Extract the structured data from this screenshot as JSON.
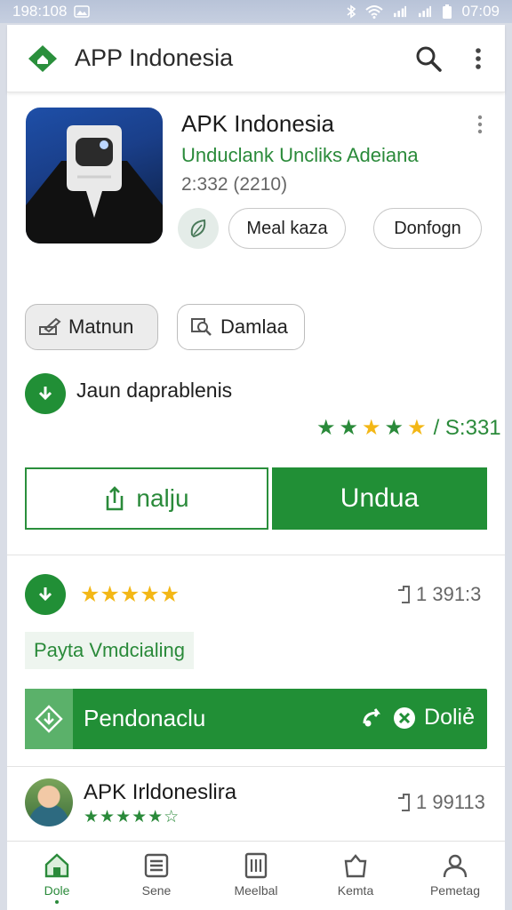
{
  "status_bar": {
    "left_text": "198:108",
    "time": "07:09"
  },
  "top_bar": {
    "title": "APP Indonesia",
    "icons": [
      "home-logo-icon",
      "search-icon",
      "more-vert-icon"
    ]
  },
  "app_card": {
    "name": "APK Indonesia",
    "subtitle": "Unduclank Uncliks Adeiana",
    "meta": "2:332 (2210)",
    "buttons": [
      "Meal kaza",
      "Donfogn"
    ]
  },
  "chips": [
    "Matnun",
    "Damlaa"
  ],
  "info": {
    "label": "Jaun daprablenis",
    "rating_stars": 5,
    "rating_suffix": "/ S:331"
  },
  "actions": {
    "secondary_label": "nalju",
    "primary_label": "Undua"
  },
  "download_row": {
    "stars": "★★★★★",
    "count": "1 391:3"
  },
  "paid_label": "Payta Vmdcialing",
  "download_bar": {
    "label": "Pendonaclu",
    "right_label": "Doliẻ"
  },
  "review": {
    "name": "APK Irldoneslira",
    "stars": "★★★★★☆",
    "count": "1 99113"
  },
  "bottom_nav": [
    {
      "label": "Dole",
      "icon": "home-icon",
      "active": true
    },
    {
      "label": "Sene",
      "icon": "list-icon",
      "active": false
    },
    {
      "label": "Meelbal",
      "icon": "book-icon",
      "active": false
    },
    {
      "label": "Kemta",
      "icon": "bag-icon",
      "active": false
    },
    {
      "label": "Pemetag",
      "icon": "person-icon",
      "active": false
    }
  ],
  "colors": {
    "accent": "#218f36",
    "star": "#f3b716",
    "text_green": "#2a8a3a"
  }
}
